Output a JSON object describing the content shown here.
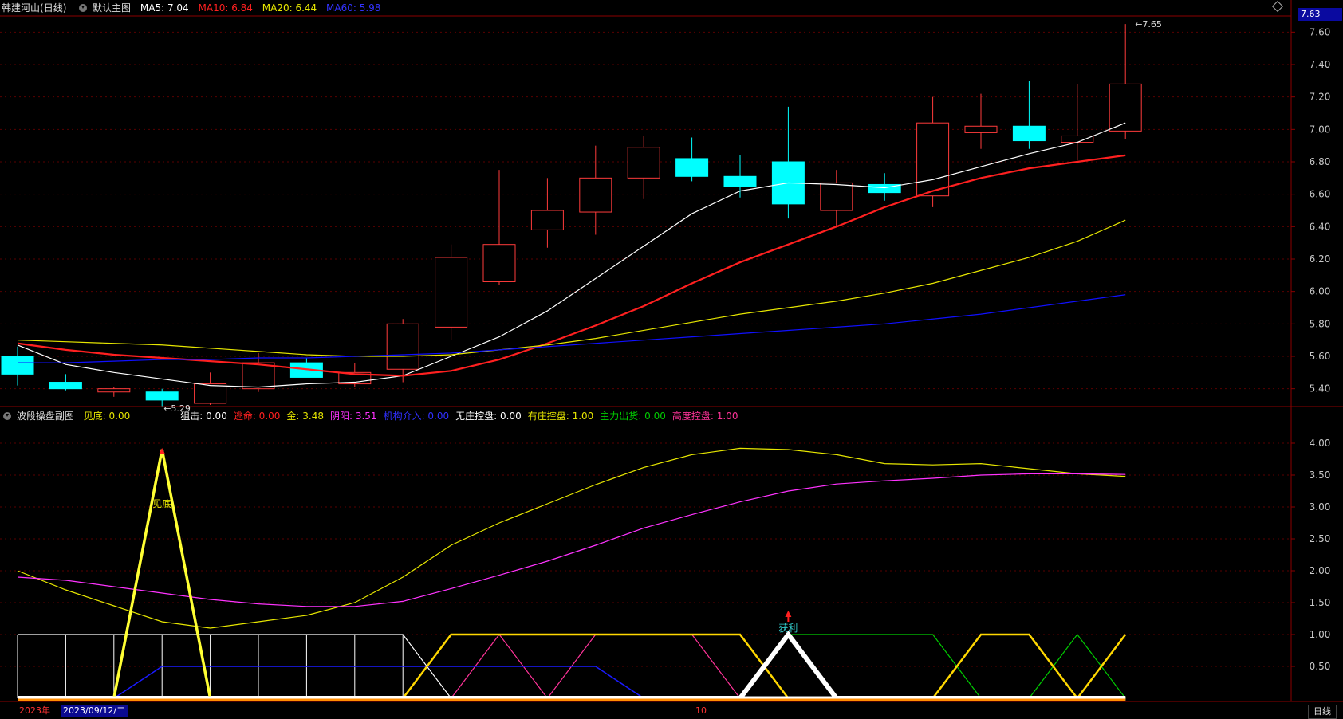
{
  "header": {
    "stock_name": "韩建河山",
    "period": "(日线)",
    "main_chart_name": "默认主图",
    "ma5_label": "MA5: 7.04",
    "ma10_label": "MA10: 6.84",
    "ma20_label": "MA20: 6.44",
    "ma60_label": "MA60: 5.98"
  },
  "colors": {
    "up": "#ff3b3b",
    "down": "#00ffff",
    "ma5": "#ffffff",
    "ma10": "#ff2020",
    "ma20": "#e6e600",
    "ma60": "#1010ff",
    "axis": "#8b0000",
    "grid": "#5a0000"
  },
  "price_badge": "7.63",
  "max_label": "7.65",
  "min_label": "5.29",
  "sub_header": {
    "name": "波段操盘副图",
    "items": [
      {
        "text": "见底: 0.00",
        "color": "#e6e600"
      },
      {
        "text": "狙击: 0.00",
        "color": "#ffffff"
      },
      {
        "text": "逃命: 0.00",
        "color": "#ff2020"
      },
      {
        "text": "金: 3.48",
        "color": "#e6e600"
      },
      {
        "text": "阴阳: 3.51",
        "color": "#ff33ff"
      },
      {
        "text": "机构介入: 0.00",
        "color": "#3030ff"
      },
      {
        "text": "无庄控盘: 0.00",
        "color": "#ffffff"
      },
      {
        "text": "有庄控盘: 1.00",
        "color": "#e6e600"
      },
      {
        "text": "主力出货: 0.00",
        "color": "#00cc00"
      },
      {
        "text": "高度控盘: 1.00",
        "color": "#ff3399"
      }
    ]
  },
  "annotations": {
    "bottom_signal": "见底",
    "profit_signal": "获利"
  },
  "footer": {
    "year": "2023年",
    "date": "2023/09/12/二",
    "month_mark": "10",
    "period": "日线"
  },
  "chart_data": [
    {
      "type": "candlestick",
      "title": "韩建河山 (日线)",
      "ylim": [
        5.3,
        7.7
      ],
      "yticks": [
        "7.60",
        "7.40",
        "7.20",
        "7.00",
        "6.80",
        "6.60",
        "6.40",
        "6.20",
        "6.00",
        "5.80",
        "5.60",
        "5.40"
      ],
      "candles": [
        {
          "o": 5.6,
          "h": 5.66,
          "l": 5.42,
          "c": 5.49
        },
        {
          "o": 5.44,
          "h": 5.49,
          "l": 5.39,
          "c": 5.4
        },
        {
          "o": 5.38,
          "h": 5.41,
          "l": 5.35,
          "c": 5.4
        },
        {
          "o": 5.38,
          "h": 5.4,
          "l": 5.29,
          "c": 5.33
        },
        {
          "o": 5.31,
          "h": 5.5,
          "l": 5.3,
          "c": 5.43
        },
        {
          "o": 5.4,
          "h": 5.62,
          "l": 5.38,
          "c": 5.56
        },
        {
          "o": 5.56,
          "h": 5.59,
          "l": 5.47,
          "c": 5.47
        },
        {
          "o": 5.43,
          "h": 5.56,
          "l": 5.41,
          "c": 5.5
        },
        {
          "o": 5.52,
          "h": 5.83,
          "l": 5.44,
          "c": 5.8
        },
        {
          "o": 5.78,
          "h": 6.29,
          "l": 5.7,
          "c": 6.21
        },
        {
          "o": 6.06,
          "h": 6.75,
          "l": 6.04,
          "c": 6.29
        },
        {
          "o": 6.38,
          "h": 6.7,
          "l": 6.27,
          "c": 6.5
        },
        {
          "o": 6.49,
          "h": 6.9,
          "l": 6.35,
          "c": 6.7
        },
        {
          "o": 6.7,
          "h": 6.96,
          "l": 6.57,
          "c": 6.89
        },
        {
          "o": 6.82,
          "h": 6.95,
          "l": 6.68,
          "c": 6.71
        },
        {
          "o": 6.71,
          "h": 6.84,
          "l": 6.58,
          "c": 6.65
        },
        {
          "o": 6.8,
          "h": 7.14,
          "l": 6.45,
          "c": 6.54
        },
        {
          "o": 6.5,
          "h": 6.75,
          "l": 6.4,
          "c": 6.67
        },
        {
          "o": 6.66,
          "h": 6.73,
          "l": 6.56,
          "c": 6.61
        },
        {
          "o": 6.59,
          "h": 7.2,
          "l": 6.52,
          "c": 7.04
        },
        {
          "o": 6.98,
          "h": 7.22,
          "l": 6.88,
          "c": 7.02
        },
        {
          "o": 7.02,
          "h": 7.3,
          "l": 6.88,
          "c": 6.93
        },
        {
          "o": 6.92,
          "h": 7.28,
          "l": 6.81,
          "c": 6.96
        },
        {
          "o": 6.99,
          "h": 7.65,
          "l": 6.94,
          "c": 7.28
        }
      ],
      "series": [
        {
          "name": "MA5",
          "values": [
            5.67,
            5.55,
            5.5,
            5.46,
            5.42,
            5.41,
            5.43,
            5.44,
            5.48,
            5.6,
            5.72,
            5.88,
            6.08,
            6.28,
            6.48,
            6.62,
            6.67,
            6.66,
            6.64,
            6.69,
            6.77,
            6.85,
            6.92,
            7.04
          ]
        },
        {
          "name": "MA10",
          "values": [
            5.68,
            5.64,
            5.61,
            5.59,
            5.57,
            5.55,
            5.52,
            5.49,
            5.48,
            5.51,
            5.58,
            5.68,
            5.79,
            5.91,
            6.05,
            6.18,
            6.29,
            6.4,
            6.52,
            6.62,
            6.7,
            6.76,
            6.8,
            6.84
          ]
        },
        {
          "name": "MA20",
          "values": [
            5.7,
            5.69,
            5.68,
            5.67,
            5.65,
            5.63,
            5.61,
            5.6,
            5.6,
            5.61,
            5.64,
            5.67,
            5.71,
            5.76,
            5.81,
            5.86,
            5.9,
            5.94,
            5.99,
            6.05,
            6.13,
            6.21,
            6.31,
            6.44
          ]
        },
        {
          "name": "MA60",
          "values": [
            5.56,
            5.56,
            5.57,
            5.58,
            5.58,
            5.59,
            5.59,
            5.6,
            5.61,
            5.62,
            5.64,
            5.66,
            5.68,
            5.7,
            5.72,
            5.74,
            5.76,
            5.78,
            5.8,
            5.83,
            5.86,
            5.9,
            5.94,
            5.98
          ]
        }
      ]
    },
    {
      "type": "line",
      "title": "波段操盘副图",
      "ylim": [
        0,
        4.3
      ],
      "yticks": [
        "4.00",
        "3.50",
        "3.00",
        "2.50",
        "2.00",
        "1.50",
        "1.00",
        "0.50"
      ],
      "series": [
        {
          "name": "金",
          "values": [
            2.0,
            1.7,
            1.45,
            1.2,
            1.1,
            1.2,
            1.3,
            1.5,
            1.9,
            2.4,
            2.75,
            3.05,
            3.35,
            3.62,
            3.82,
            3.92,
            3.9,
            3.82,
            3.68,
            3.66,
            3.68,
            3.6,
            3.52,
            3.48
          ]
        },
        {
          "name": "阴阳",
          "values": [
            1.9,
            1.85,
            1.75,
            1.65,
            1.55,
            1.48,
            1.44,
            1.44,
            1.52,
            1.72,
            1.93,
            2.15,
            2.4,
            2.67,
            2.88,
            3.08,
            3.25,
            3.36,
            3.41,
            3.45,
            3.5,
            3.52,
            3.52,
            3.51
          ]
        },
        {
          "name": "见底",
          "values": [
            0,
            0,
            0,
            3.9,
            0,
            0,
            0,
            0,
            0,
            0,
            0,
            0,
            0,
            0,
            0,
            0,
            0,
            0,
            0,
            0,
            0,
            0,
            0,
            0
          ]
        },
        {
          "name": "机构介入",
          "values": [
            0,
            0,
            0,
            0.5,
            0.5,
            0.5,
            0.5,
            0.5,
            0.5,
            0.5,
            0.5,
            0.5,
            0.5,
            0,
            0,
            0,
            0,
            0,
            0,
            0,
            0,
            0,
            0,
            0
          ]
        },
        {
          "name": "无庄控盘",
          "values": [
            1,
            1,
            1,
            1,
            1,
            1,
            1,
            1,
            1,
            0,
            0,
            0,
            0,
            0,
            0,
            0,
            0,
            0,
            0,
            0,
            0,
            0,
            0,
            0
          ]
        },
        {
          "name": "有庄控盘",
          "values": [
            0,
            0,
            0,
            0,
            0,
            0,
            0,
            0,
            0,
            1,
            1,
            1,
            1,
            1,
            1,
            1,
            0,
            0,
            0,
            0,
            1,
            1,
            0,
            1
          ]
        },
        {
          "name": "主力出货",
          "values": [
            0,
            0,
            0,
            0,
            0,
            0,
            0,
            0,
            0,
            0,
            0,
            0,
            0,
            0,
            0,
            0,
            1,
            1,
            1,
            1,
            0,
            0,
            1,
            0
          ]
        },
        {
          "name": "高度控盘",
          "values": [
            0,
            0,
            0,
            0,
            0,
            0,
            0,
            0,
            0,
            0,
            1,
            0,
            1,
            1,
            1,
            0,
            0,
            0,
            0,
            0,
            1,
            1,
            0,
            1
          ]
        },
        {
          "name": "狙击",
          "values": [
            0,
            0,
            0,
            0,
            0,
            0,
            0,
            0,
            0,
            0,
            0,
            0,
            0,
            0,
            0,
            0,
            1,
            0,
            0,
            0,
            0,
            0,
            0,
            0
          ]
        }
      ]
    }
  ]
}
